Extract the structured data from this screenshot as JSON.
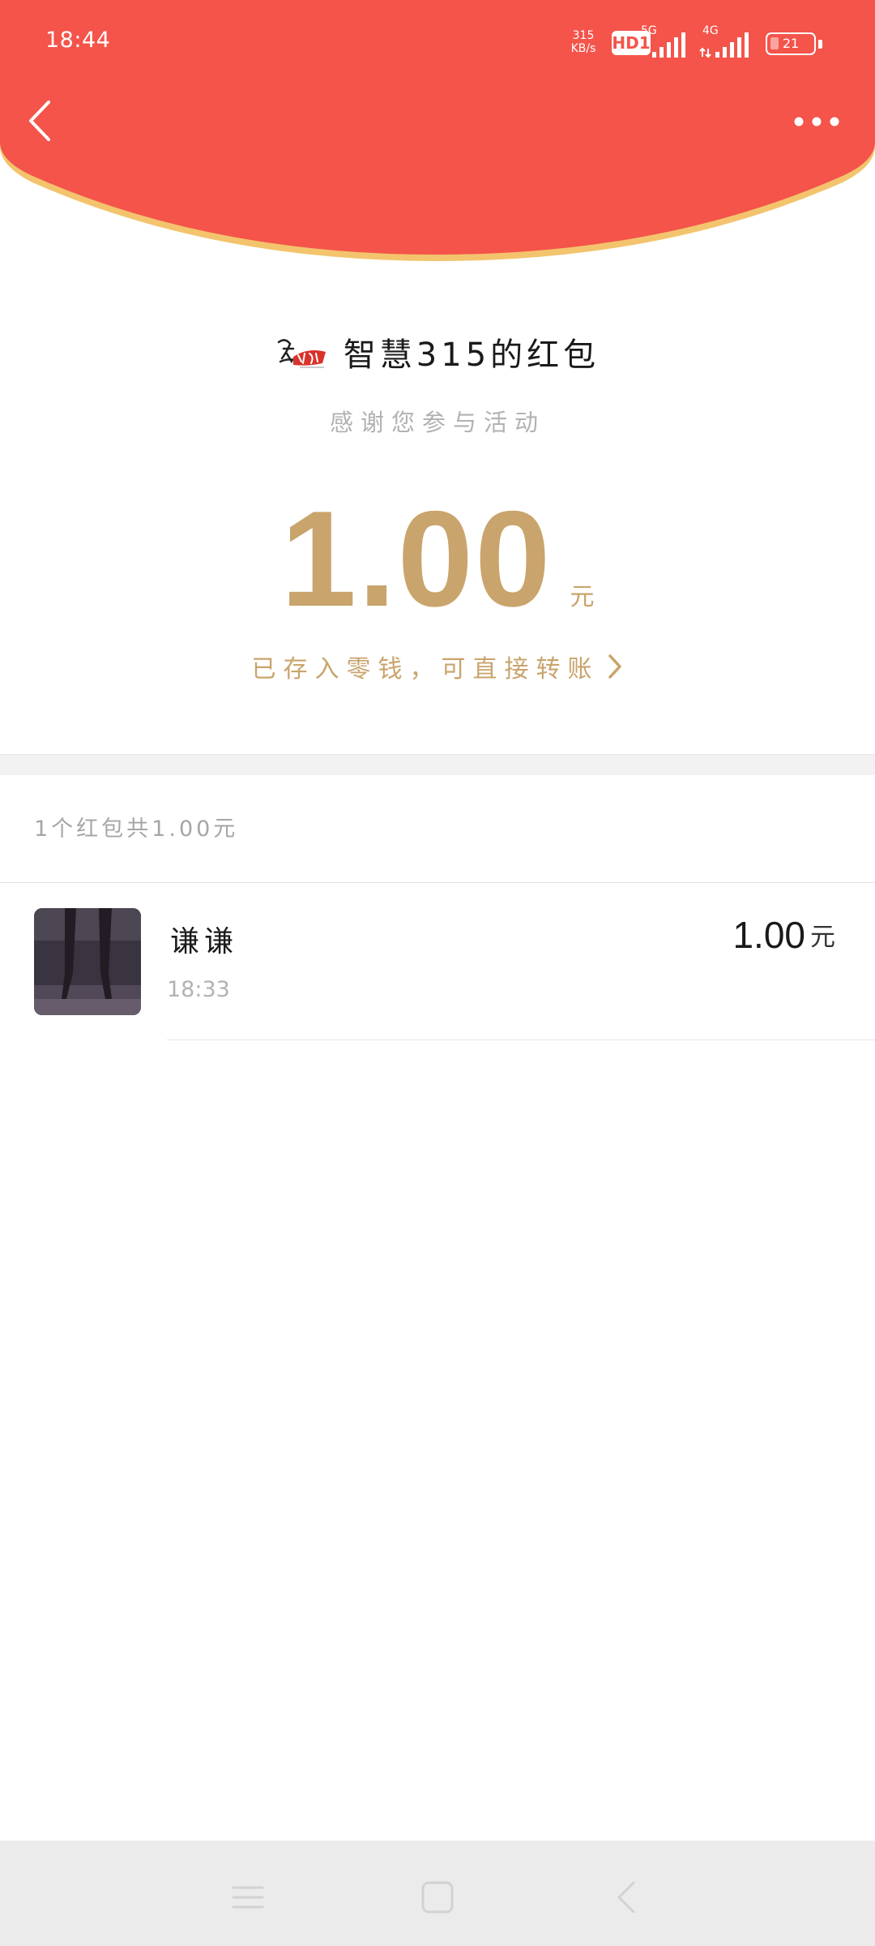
{
  "status_bar": {
    "time": "18:44",
    "net_speed_value": "315",
    "net_speed_unit": "KB/s",
    "hd_badge": "HD1",
    "network_5g": "5G",
    "network_4g": "4G",
    "battery_level": "21",
    "icons": [
      "signal-5g-icon",
      "signal-4g-icon",
      "battery-icon"
    ]
  },
  "header": {
    "background_color": "#f4544a",
    "accent_border_color": "#f3c46d",
    "back_icon": "chevron-left-icon",
    "more_icon": "more-dots-icon"
  },
  "packet": {
    "sender_name": "智慧315的红包",
    "blessing": "感谢您参与活动",
    "amount": "1.00",
    "amount_unit": "元",
    "status_link": "已存入零钱，可直接转账",
    "gold_color": "#c9a46c"
  },
  "summary": {
    "text": "1个红包共1.00元"
  },
  "records": [
    {
      "name": "谦谦",
      "time": "18:33",
      "amount": "1.00",
      "unit": "元"
    }
  ],
  "nav_bar": {
    "icons": [
      "menu-icon",
      "home-icon",
      "back-icon"
    ]
  }
}
